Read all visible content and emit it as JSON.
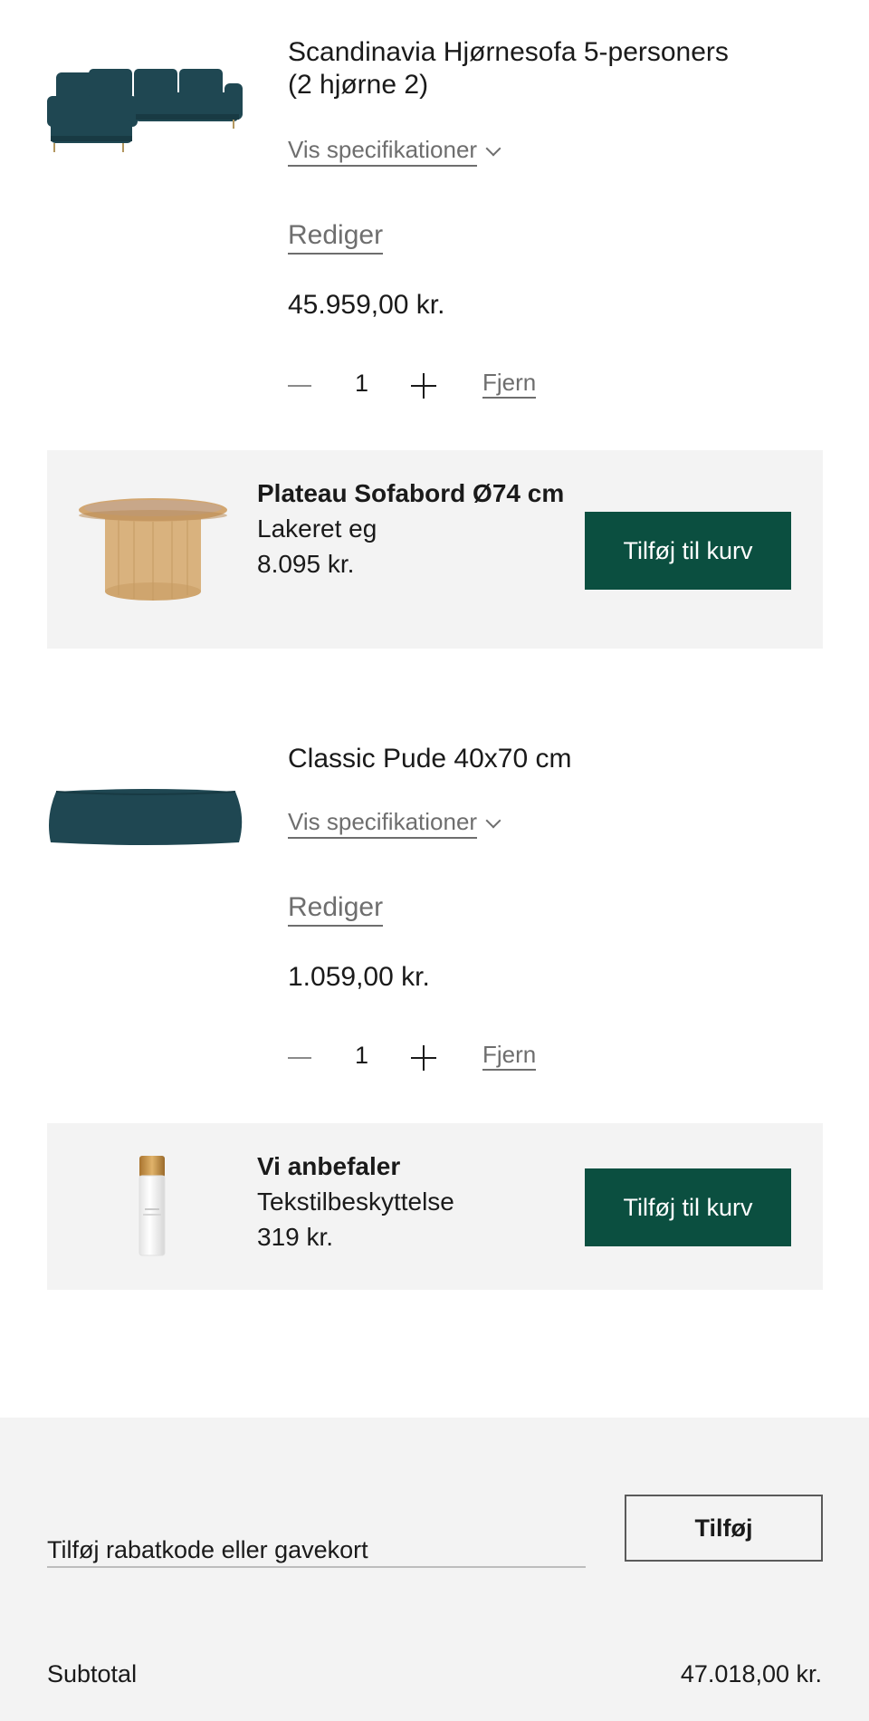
{
  "cart": {
    "items": [
      {
        "title": "Scandinavia Hjørnesofa 5-personers (2 hjørne 2)",
        "spec_label": "Vis specifikationer",
        "edit_label": "Rediger",
        "price": "45.959,00 kr.",
        "quantity": "1",
        "remove_label": "Fjern",
        "image": "corner-sofa-image",
        "image_color": "#1f4752"
      },
      {
        "title": "Classic Pude 40x70 cm",
        "spec_label": "Vis specifikationer",
        "edit_label": "Rediger",
        "price": "1.059,00 kr.",
        "quantity": "1",
        "remove_label": "Fjern",
        "image": "cushion-image",
        "image_color": "#1f4752"
      }
    ]
  },
  "recommendations": [
    {
      "title": "Plateau Sofabord Ø74 cm",
      "subtitle": "Lakeret eg",
      "price": "8.095 kr.",
      "button_label": "Tilføj til kurv",
      "image": "coffee-table-image"
    },
    {
      "title": "Vi anbefaler",
      "subtitle": "Tekstilbeskyttelse",
      "price": "319 kr.",
      "button_label": "Tilføj til kurv",
      "image": "spray-bottle-image"
    }
  ],
  "promo": {
    "placeholder": "Tilføj rabatkode eller gavekort",
    "button_label": "Tilføj"
  },
  "summary": {
    "subtotal_label": "Subtotal",
    "subtotal_value": "47.018,00 kr."
  },
  "colors": {
    "accent": "#0b4f40",
    "panel": "#f3f3f3",
    "muted_text": "#6e6e6e"
  }
}
